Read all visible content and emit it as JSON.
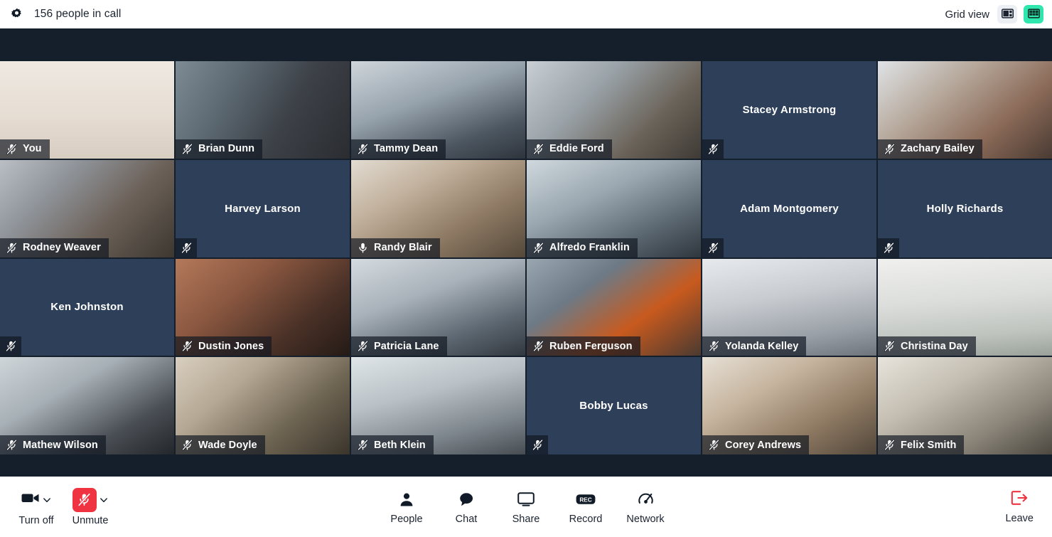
{
  "header": {
    "gear_icon": "gear-icon",
    "title": "156 people in call",
    "view_label": "Grid view",
    "sidebar_view_icon": "sidebar-view-icon",
    "grid_view_icon": "grid-view-icon",
    "active_view": "grid",
    "accent_color": "#2ee6ae"
  },
  "stage": {
    "background_color": "#151e2b",
    "camera_off_color": "#2e4059",
    "speaking_border_color": "#f5c518",
    "columns": 6,
    "rows": 4,
    "participants": [
      {
        "name": "You",
        "muted": true,
        "camera_on": true,
        "speaking": false,
        "scene": "s1"
      },
      {
        "name": "Brian Dunn",
        "muted": true,
        "camera_on": true,
        "speaking": false,
        "scene": "s2"
      },
      {
        "name": "Tammy Dean",
        "muted": true,
        "camera_on": true,
        "speaking": false,
        "scene": "s3"
      },
      {
        "name": "Eddie Ford",
        "muted": true,
        "camera_on": true,
        "speaking": false,
        "scene": "s4"
      },
      {
        "name": "Stacey Armstrong",
        "muted": true,
        "camera_on": false,
        "speaking": false,
        "scene": ""
      },
      {
        "name": "Zachary Bailey",
        "muted": true,
        "camera_on": true,
        "speaking": false,
        "scene": "s5"
      },
      {
        "name": "Rodney Weaver",
        "muted": true,
        "camera_on": true,
        "speaking": false,
        "scene": "s6"
      },
      {
        "name": "Harvey Larson",
        "muted": true,
        "camera_on": false,
        "speaking": false,
        "scene": ""
      },
      {
        "name": "Randy Blair",
        "muted": false,
        "camera_on": true,
        "speaking": true,
        "scene": "s7"
      },
      {
        "name": "Alfredo Franklin",
        "muted": true,
        "camera_on": true,
        "speaking": false,
        "scene": "s8"
      },
      {
        "name": "Adam Montgomery",
        "muted": true,
        "camera_on": false,
        "speaking": false,
        "scene": ""
      },
      {
        "name": "Holly Richards",
        "muted": true,
        "camera_on": false,
        "speaking": false,
        "scene": ""
      },
      {
        "name": "Ken Johnston",
        "muted": true,
        "camera_on": false,
        "speaking": false,
        "scene": ""
      },
      {
        "name": "Dustin Jones",
        "muted": true,
        "camera_on": true,
        "speaking": false,
        "scene": "s9"
      },
      {
        "name": "Patricia Lane",
        "muted": true,
        "camera_on": true,
        "speaking": false,
        "scene": "s10"
      },
      {
        "name": "Ruben Ferguson",
        "muted": true,
        "camera_on": true,
        "speaking": false,
        "scene": "s11"
      },
      {
        "name": "Yolanda Kelley",
        "muted": true,
        "camera_on": true,
        "speaking": false,
        "scene": "s12"
      },
      {
        "name": "Christina Day",
        "muted": true,
        "camera_on": true,
        "speaking": false,
        "scene": "s13"
      },
      {
        "name": "Mathew Wilson",
        "muted": true,
        "camera_on": true,
        "speaking": false,
        "scene": "s14"
      },
      {
        "name": "Wade Doyle",
        "muted": true,
        "camera_on": true,
        "speaking": false,
        "scene": "s15"
      },
      {
        "name": "Beth Klein",
        "muted": true,
        "camera_on": true,
        "speaking": false,
        "scene": "s16"
      },
      {
        "name": "Bobby Lucas",
        "muted": true,
        "camera_on": false,
        "speaking": false,
        "scene": ""
      },
      {
        "name": "Corey Andrews",
        "muted": true,
        "camera_on": true,
        "speaking": false,
        "scene": "s17"
      },
      {
        "name": "Felix Smith",
        "muted": true,
        "camera_on": true,
        "speaking": false,
        "scene": "s18"
      }
    ]
  },
  "footer": {
    "camera": {
      "label": "Turn off",
      "icon": "camera-icon",
      "state": "on"
    },
    "mic": {
      "label": "Unmute",
      "icon": "mic-off-icon",
      "state": "muted",
      "color": "#ef3340"
    },
    "center": [
      {
        "label": "People",
        "icon": "people-icon"
      },
      {
        "label": "Chat",
        "icon": "chat-icon"
      },
      {
        "label": "Share",
        "icon": "screen-share-icon"
      },
      {
        "label": "Record",
        "icon": "record-icon"
      },
      {
        "label": "Network",
        "icon": "network-gauge-icon"
      }
    ],
    "leave": {
      "label": "Leave",
      "icon": "leave-icon",
      "color": "#ef3340"
    }
  }
}
